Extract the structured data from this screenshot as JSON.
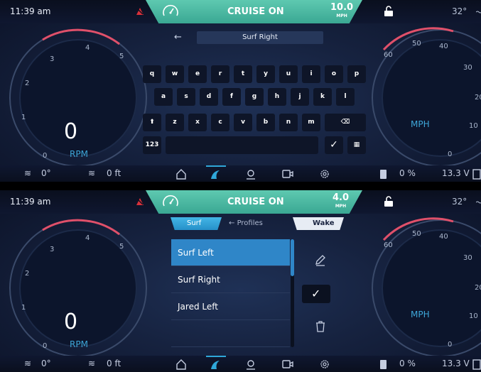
{
  "colors": {
    "accent": "#2f86c8",
    "cruise": "#4cb8a0",
    "redline": "#e0506a",
    "teal_unit": "#3ea6d8"
  },
  "status": {
    "time": "11:39 am",
    "cruise_label": "CRUISE ON",
    "cruise_unit": "MPH",
    "temp": "32°"
  },
  "panels": [
    {
      "cruise_speed": "10.0"
    },
    {
      "cruise_speed": "4.0"
    }
  ],
  "dials": {
    "rpm": {
      "value": "0",
      "unit": "RPM",
      "ticks": [
        "0",
        "1",
        "2",
        "3",
        "4",
        "5"
      ]
    },
    "mph": {
      "unit": "MPH",
      "ticks": [
        "0",
        "10",
        "20",
        "30",
        "40",
        "50",
        "60"
      ]
    }
  },
  "navbar": {
    "water_temp": "0°",
    "depth": "0 ft",
    "fuel": "0 %",
    "voltage": "13.3 V"
  },
  "keyboard": {
    "search_value": "Surf Right",
    "rows": [
      [
        "q",
        "w",
        "e",
        "r",
        "t",
        "y",
        "u",
        "i",
        "o",
        "p"
      ],
      [
        "a",
        "s",
        "d",
        "f",
        "g",
        "h",
        "j",
        "k",
        "l"
      ],
      [
        "z",
        "x",
        "c",
        "v",
        "b",
        "n",
        "m"
      ]
    ],
    "numeric_label": "123"
  },
  "profiles": {
    "tab_surf": "Surf",
    "tab_profiles": "Profiles",
    "tab_wake": "Wake",
    "items": [
      "Surf Left",
      "Surf Right",
      "Jared Left"
    ]
  }
}
